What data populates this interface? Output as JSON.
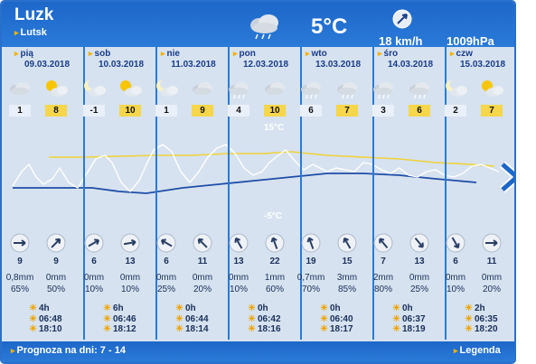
{
  "header": {
    "city": "Luzk",
    "subcity": "Lutsk",
    "temp": "5°C",
    "wind": "18 km/h",
    "pressure": "1009hPa",
    "weather_icon": "rain-cloud-icon",
    "wind_icon": "wind-compass-icon"
  },
  "days": [
    {
      "name": "pią",
      "date": "09.03.2018"
    },
    {
      "name": "sob",
      "date": "10.03.2018"
    },
    {
      "name": "nie",
      "date": "11.03.2018"
    },
    {
      "name": "pon",
      "date": "12.03.2018"
    },
    {
      "name": "wto",
      "date": "13.03.2018"
    },
    {
      "name": "śro",
      "date": "14.03.2018"
    },
    {
      "name": "czw",
      "date": "15.03.2018"
    }
  ],
  "icons": [
    "cloudy-icon",
    "sun-cloud-icon",
    "moon-cloud-icon",
    "sun-cloud-icon",
    "moon-cloud-icon",
    "cloudy-icon",
    "rain-cloud-icon",
    "cloudy-icon",
    "rain-cloud-icon",
    "rain-cloud-icon",
    "rain-cloud-icon",
    "rain-cloud-icon",
    "moon-cloud-icon",
    "sun-cloud-icon"
  ],
  "temps": [
    "1",
    "8",
    "-1",
    "10",
    "1",
    "9",
    "4",
    "10",
    "6",
    "7",
    "3",
    "6",
    "2",
    "7"
  ],
  "plot_labels": {
    "top": "15°C",
    "bottom": "-5°C"
  },
  "wind_speeds": [
    "9",
    "9",
    "6",
    "13",
    "6",
    "11",
    "13",
    "22",
    "19",
    "15",
    "7",
    "13",
    "6",
    "11"
  ],
  "wind_dirs": [
    90,
    45,
    60,
    80,
    300,
    315,
    330,
    340,
    340,
    330,
    320,
    140,
    150,
    90
  ],
  "precip": [
    {
      "mm": "0,8mm",
      "pct": "65%"
    },
    {
      "mm": "0mm",
      "pct": "50%"
    },
    {
      "mm": "0mm",
      "pct": "10%"
    },
    {
      "mm": "0mm",
      "pct": "10%"
    },
    {
      "mm": "0mm",
      "pct": "25%"
    },
    {
      "mm": "0mm",
      "pct": "20%"
    },
    {
      "mm": "0mm",
      "pct": "10%"
    },
    {
      "mm": "1mm",
      "pct": "60%"
    },
    {
      "mm": "0,7mm",
      "pct": "70%"
    },
    {
      "mm": "3mm",
      "pct": "85%"
    },
    {
      "mm": "2mm",
      "pct": "80%"
    },
    {
      "mm": "0mm",
      "pct": "25%"
    },
    {
      "mm": "0mm",
      "pct": "10%"
    },
    {
      "mm": "0mm",
      "pct": "20%"
    }
  ],
  "sun": [
    {
      "hours": "4h",
      "rise": "06:48",
      "set": "18:10"
    },
    {
      "hours": "6h",
      "rise": "06:46",
      "set": "18:12"
    },
    {
      "hours": "0h",
      "rise": "06:44",
      "set": "18:14"
    },
    {
      "hours": "0h",
      "rise": "06:42",
      "set": "18:16"
    },
    {
      "hours": "0h",
      "rise": "06:40",
      "set": "18:17"
    },
    {
      "hours": "0h",
      "rise": "06:37",
      "set": "18:19"
    },
    {
      "hours": "2h",
      "rise": "06:35",
      "set": "18:20"
    }
  ],
  "footer": {
    "forecast": "Prognoza na dni: 7 - 14",
    "legend": "Legenda"
  },
  "colors": {
    "header": "#1d67c9",
    "day_temp": "#f6d64a",
    "night_temp": "#e9f0fa",
    "line_yellow": "#f0d23a",
    "line_blue": "#1f4ea8"
  }
}
